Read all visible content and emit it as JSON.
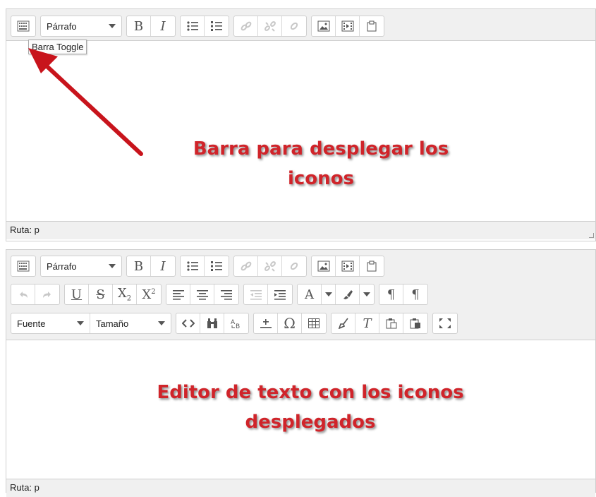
{
  "toolbar": {
    "paragraph_select": "Párrafo",
    "font_select": "Fuente",
    "size_select": "Tamaño",
    "bold": "B",
    "italic": "I",
    "underline": "U",
    "strike": "S",
    "subscript_base": "X",
    "subscript_sub": "2",
    "superscript_base": "X",
    "superscript_sup": "2",
    "omega": "Ω",
    "clear_format": "T",
    "pilcrow": "¶",
    "textcolor": "A"
  },
  "tooltip": "Barra Toggle",
  "editor1": {
    "status": "Ruta: p"
  },
  "editor2": {
    "status": "Ruta: p"
  },
  "annotations": {
    "top_line1": "Barra para desplegar los",
    "top_line2": "iconos",
    "bottom_line1": "Editor de texto con los iconos",
    "bottom_line2": "desplegados"
  },
  "colors": {
    "annotation": "#d0242a",
    "arrow": "#c8141c",
    "toolbar_bg": "#f0f0f0",
    "border": "#cfcfcf"
  }
}
